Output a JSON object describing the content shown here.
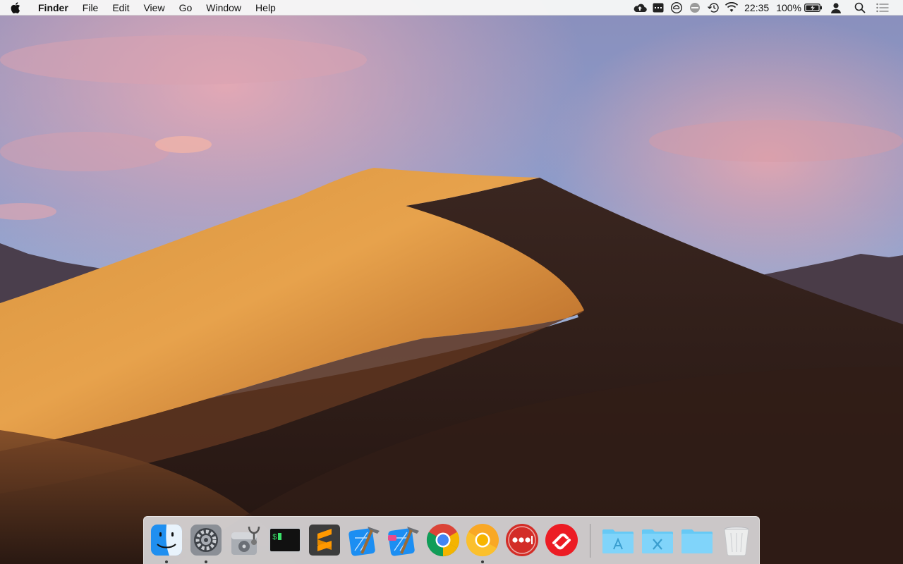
{
  "menubar": {
    "apple_icon": "apple-logo-icon",
    "menus": [
      {
        "label": "Finder",
        "app": true
      },
      {
        "label": "File"
      },
      {
        "label": "Edit"
      },
      {
        "label": "View"
      },
      {
        "label": "Go"
      },
      {
        "label": "Window"
      },
      {
        "label": "Help"
      }
    ],
    "status": {
      "icons": [
        "cloud-upload-icon",
        "menu-extra-icon",
        "creative-cloud-icon",
        "do-not-disturb-icon",
        "time-machine-icon",
        "wifi-icon"
      ],
      "clock": "22:35",
      "battery_percent": "100%",
      "battery_icon": "battery-charging-icon",
      "user_icon": "user-icon",
      "spotlight_icon": "spotlight-search-icon",
      "notification_icon": "notification-center-icon"
    }
  },
  "dock": {
    "apps": [
      {
        "name": "Finder",
        "icon": "finder-icon",
        "running": true
      },
      {
        "name": "System Preferences",
        "icon": "system-preferences-icon",
        "running": true
      },
      {
        "name": "Disk Utility",
        "icon": "disk-utility-icon",
        "running": false
      },
      {
        "name": "Terminal",
        "icon": "terminal-icon",
        "running": false
      },
      {
        "name": "Sublime Text",
        "icon": "sublime-text-icon",
        "running": false
      },
      {
        "name": "Xcode",
        "icon": "xcode-icon",
        "running": false
      },
      {
        "name": "Xcode-beta",
        "icon": "xcode-beta-icon",
        "running": false
      },
      {
        "name": "Google Chrome",
        "icon": "chrome-icon",
        "running": false
      },
      {
        "name": "Chrome Canary",
        "icon": "chrome-canary-icon",
        "running": true
      },
      {
        "name": "LastPass",
        "icon": "lastpass-icon",
        "running": false
      },
      {
        "name": "Authy",
        "icon": "authy-icon",
        "running": false
      }
    ],
    "stacks": [
      {
        "name": "Applications",
        "icon": "applications-folder-icon"
      },
      {
        "name": "Utilities",
        "icon": "utilities-folder-icon"
      },
      {
        "name": "Folder",
        "icon": "folder-icon"
      },
      {
        "name": "Trash",
        "icon": "trash-icon"
      }
    ]
  },
  "colors": {
    "menubar_bg": "#f6f6f6",
    "folder_blue": "#66c9f5",
    "dune_light": "#e29a45",
    "dune_shadow": "#2e1c16"
  }
}
